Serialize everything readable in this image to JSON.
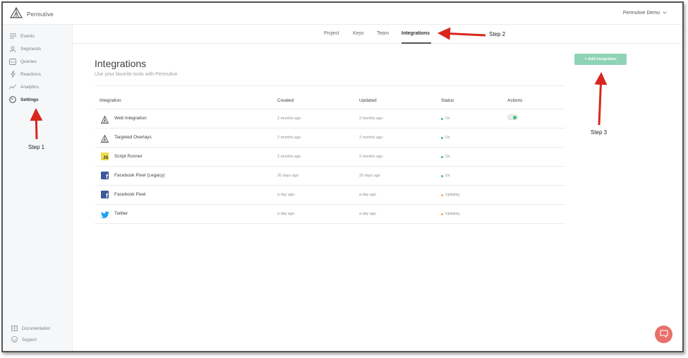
{
  "brand": {
    "name": "Permutive"
  },
  "user_menu": {
    "label": "Permutive Demo"
  },
  "sidebar": {
    "items": [
      {
        "label": "Events",
        "icon": "list-icon"
      },
      {
        "label": "Segments",
        "icon": "users-icon"
      },
      {
        "label": "Queries",
        "icon": "sql-icon"
      },
      {
        "label": "Reactions",
        "icon": "bolt-icon"
      },
      {
        "label": "Analytics",
        "icon": "trend-icon"
      },
      {
        "label": "Settings",
        "icon": "gauge-icon",
        "active": true
      }
    ],
    "footer": [
      {
        "label": "Documentation",
        "icon": "book-icon"
      },
      {
        "label": "Support",
        "icon": "support-icon"
      }
    ]
  },
  "subnav": {
    "tabs": [
      {
        "label": "Project"
      },
      {
        "label": "Keys"
      },
      {
        "label": "Team"
      },
      {
        "label": "Integrations",
        "active": true
      }
    ]
  },
  "page": {
    "title": "Integrations",
    "subtitle": "Use your favorite tools with Permutive",
    "add_button": "+ Add Integration"
  },
  "table": {
    "headers": [
      "Integration",
      "Created",
      "Updated",
      "Status",
      "Actions"
    ],
    "rows": [
      {
        "name": "Web Integration",
        "created": "2 months ago",
        "updated": "2 months ago",
        "status": "On",
        "icon": "permutive-logo-icon",
        "toggle": true
      },
      {
        "name": "Targeted Overlays",
        "created": "2 months ago",
        "updated": "2 months ago",
        "status": "On",
        "icon": "permutive-logo-icon"
      },
      {
        "name": "Script Runner",
        "created": "2 months ago",
        "updated": "2 months ago",
        "status": "On",
        "icon": "js-icon",
        "icon_text": "JS"
      },
      {
        "name": "Facebook Pixel (Legacy)",
        "created": "20 days ago",
        "updated": "20 days ago",
        "status": "On",
        "icon": "facebook-icon",
        "icon_text": "f"
      },
      {
        "name": "Facebook Pixel",
        "created": "a day ago",
        "updated": "a day ago",
        "status": "Updating",
        "icon": "facebook-icon",
        "icon_text": "f"
      },
      {
        "name": "Twitter",
        "created": "a day ago",
        "updated": "a day ago",
        "status": "Updating",
        "icon": "twitter-icon"
      }
    ]
  },
  "annotations": {
    "step1": "Step 1",
    "step2": "Step 2",
    "step3": "Step 3"
  },
  "colors": {
    "accent": "#8fd3b6",
    "status_on": "#3fbf75",
    "status_updating": "#f0a855",
    "annotation_arrow": "#d9261c",
    "facebook": "#3b5998",
    "twitter": "#1da1f2",
    "js": "#f0db4f",
    "chat": "#e8716c"
  }
}
